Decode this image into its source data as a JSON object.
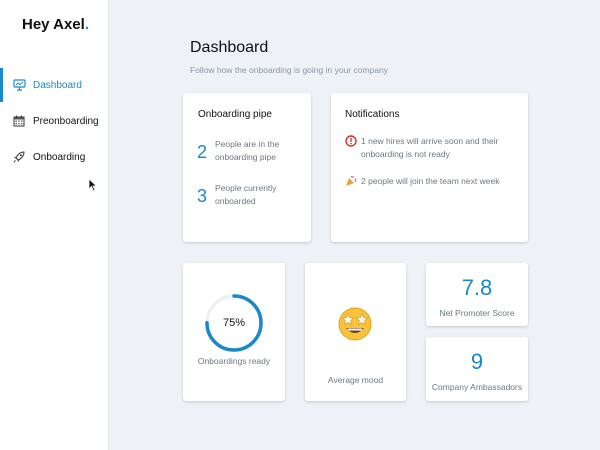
{
  "app": {
    "logo_text": "Hey Axel",
    "logo_dot": "."
  },
  "sidebar": {
    "items": [
      {
        "label": "Dashboard",
        "icon": "monitor-icon",
        "active": true
      },
      {
        "label": "Preonboarding",
        "icon": "calendar-icon",
        "active": false
      },
      {
        "label": "Onboarding",
        "icon": "rocket-icon",
        "active": false
      }
    ]
  },
  "header": {
    "title": "Dashboard",
    "subtitle": "Follow how the onboarding is going in your company"
  },
  "onboarding_pipe": {
    "title": "Onboarding pipe",
    "stats": [
      {
        "value": "2",
        "label": "People are in the onboarding pipe"
      },
      {
        "value": "3",
        "label": "People currently onboarded"
      }
    ]
  },
  "notifications": {
    "title": "Notifications",
    "items": [
      {
        "icon": "alert-icon",
        "text": "1 new hires will arrive soon and their onboarding is not ready"
      },
      {
        "icon": "party-popper-icon",
        "text": "2 people will join the team next week"
      }
    ]
  },
  "onboardings_ready": {
    "value": 75,
    "value_label": "75%",
    "label": "Onboardings ready"
  },
  "average_mood": {
    "icon": "star-struck-emoji-icon",
    "label": "Average mood"
  },
  "nps": {
    "value": "7.8",
    "label": "Net Promoter Score"
  },
  "ambassadors": {
    "value": "9",
    "label": "Company Ambassadors"
  },
  "colors": {
    "accent": "#1a88c9",
    "background": "#eef1f5",
    "card": "#ffffff",
    "muted_text": "#6c7883"
  }
}
